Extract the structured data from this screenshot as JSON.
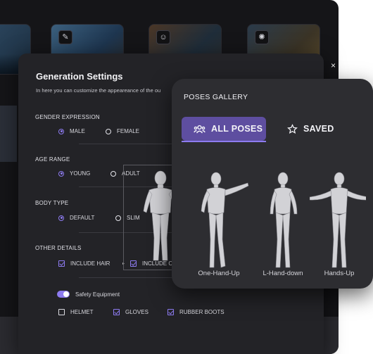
{
  "generation_settings": {
    "title": "Generation Settings",
    "subtitle": "In here you can customize the appeareance of the ou",
    "close_glyph": "×",
    "gender": {
      "label": "GENDER EXPRESSION",
      "options": [
        {
          "label": "MALE",
          "selected": true
        },
        {
          "label": "FEMALE",
          "selected": false
        }
      ]
    },
    "age": {
      "label": "AGE RANGE",
      "options": [
        {
          "label": "YOUNG",
          "selected": true
        },
        {
          "label": "ADULT",
          "selected": false
        }
      ]
    },
    "body": {
      "label": "BODY TYPE",
      "options": [
        {
          "label": "DEFAULT",
          "selected": true
        },
        {
          "label": "SLIM",
          "selected": false
        }
      ]
    },
    "other": {
      "label": "OTHER DETAILS",
      "include_hair": "INCLUDE HAIR",
      "include_other": "INCLUDE C",
      "safety_label": "Safety Equipment",
      "safety_on": true,
      "items": [
        {
          "label": "HELMET",
          "checked": false
        },
        {
          "label": "GLOVES",
          "checked": true
        },
        {
          "label": "RUBBER BOOTS",
          "checked": true
        }
      ]
    }
  },
  "poses_gallery": {
    "title": "POSES GALLERY",
    "tabs": [
      {
        "label": "ALL POSES",
        "icon": "people-icon",
        "active": true
      },
      {
        "label": "SAVED",
        "icon": "star-icon",
        "active": false
      }
    ],
    "poses": [
      {
        "label": "One-Hand-Up"
      },
      {
        "label": "L-Hand-down"
      },
      {
        "label": "Hands-Up"
      }
    ]
  },
  "colors": {
    "accent": "#8d7bf0",
    "tab_active_bg": "#5e4ea0",
    "panel_bg": "#2d2d31",
    "modal_bg": "#232327"
  }
}
